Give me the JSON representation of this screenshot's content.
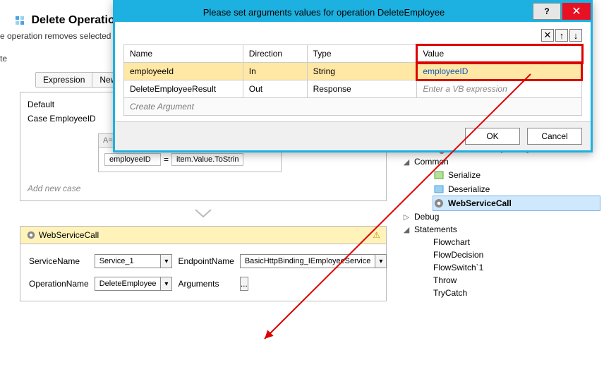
{
  "bg": {
    "title": "Delete Operation Wo",
    "subtitle": "e operation removes selected",
    "sub2": "te",
    "tabs": [
      "Expression",
      "New Ar"
    ],
    "default_label": "Default",
    "case_label": "Case  EmployeeID",
    "assign_head": "Assign",
    "assign_left": "employeeID",
    "assign_eq": "=",
    "assign_right": "item.Value.ToStrin",
    "add_case": "Add new case"
  },
  "wsc": {
    "title": "WebServiceCall",
    "rows": {
      "service_lbl": "ServiceName",
      "service_val": "Service_1",
      "operation_lbl": "OperationName",
      "operation_val": "DeleteEmployee",
      "endpoint_lbl": "EndpointName",
      "endpoint_val": "BasicHttpBinding_IEmployeeService",
      "arguments_lbl": "Arguments",
      "arguments_btn": "..."
    }
  },
  "tree": {
    "a": "CreateCSEntryChangeResult",
    "common": "Common",
    "serialize": "Serialize",
    "deserialize": "Deserialize",
    "wsc": "WebServiceCall",
    "debug": "Debug",
    "stmts": "Statements",
    "items": [
      "Flowchart",
      "FlowDecision",
      "FlowSwitch`1",
      "Throw",
      "TryCatch"
    ]
  },
  "dialog": {
    "title": "Please set arguments values for operation DeleteEmployee",
    "help": "?",
    "close": "✕",
    "ctrl_x": "✕",
    "ctrl_up": "↑",
    "ctrl_down": "↓",
    "headers": {
      "name": "Name",
      "direction": "Direction",
      "type": "Type",
      "value": "Value"
    },
    "rows": [
      {
        "name": "employeeId",
        "direction": "In",
        "type": "String",
        "value": "employeeID"
      },
      {
        "name": "DeleteEmployeeResult",
        "direction": "Out",
        "type": "Response",
        "value": ""
      }
    ],
    "value_placeholder": "Enter a VB expression",
    "create_argument": "Create Argument",
    "ok": "OK",
    "cancel": "Cancel"
  }
}
